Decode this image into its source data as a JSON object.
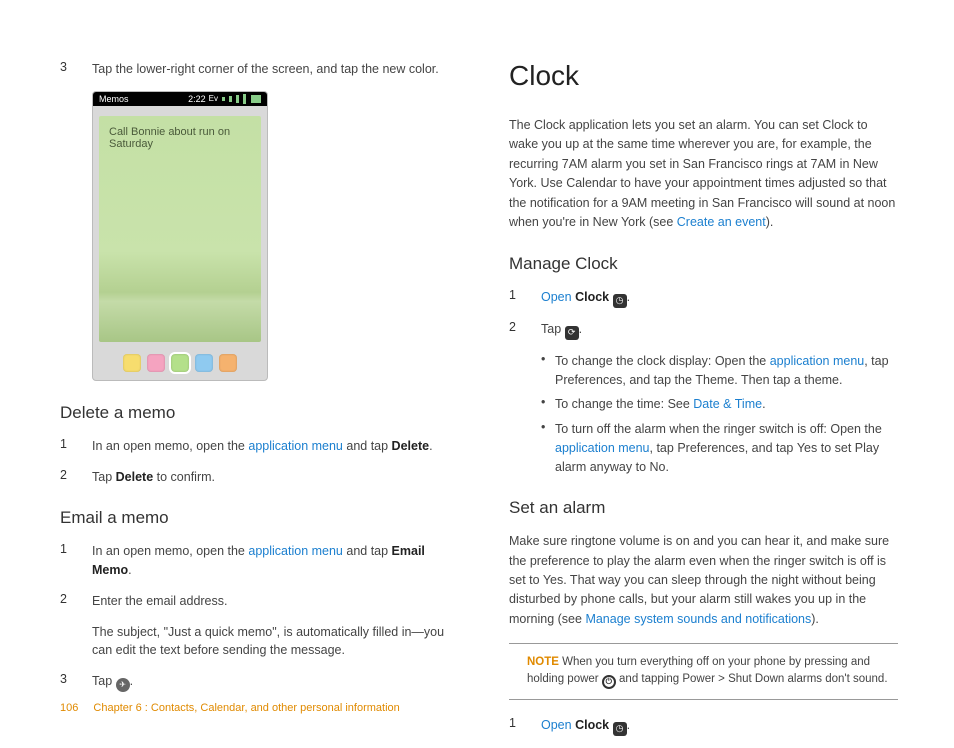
{
  "leftCol": {
    "step3_num": "3",
    "step3_text": "Tap the lower-right corner of the screen, and tap the new color.",
    "phone": {
      "title": "Memos",
      "time": "2:22",
      "memo_text": "Call Bonnie about run on Saturday"
    },
    "h_delete": "Delete a memo",
    "del1_num": "1",
    "del1_a": "In an open memo, open the ",
    "del1_link": "application menu",
    "del1_b": " and tap ",
    "del1_bold": "Delete",
    "del1_c": ".",
    "del2_num": "2",
    "del2_a": "Tap ",
    "del2_bold": "Delete",
    "del2_b": " to confirm.",
    "h_email": "Email a memo",
    "em1_num": "1",
    "em1_a": "In an open memo, open the ",
    "em1_link": "application menu",
    "em1_b": " and tap ",
    "em1_bold": "Email Memo",
    "em1_c": ".",
    "em2_num": "2",
    "em2_text": "Enter the email address.",
    "em2_sub": "The subject, \"Just a quick memo\", is automatically filled in—you can edit the text before sending the message.",
    "em3_num": "3",
    "em3_text": "Tap "
  },
  "rightCol": {
    "h1": "Clock",
    "intro_a": "The Clock application lets you set an alarm. You can set Clock to wake you up at the same time wherever you are, for example, the recurring 7AM alarm you set in San Francisco rings at 7AM in New York. Use Calendar to have your appointment times adjusted so that the notification for a 9AM meeting in San Francisco will sound at noon when you're in New York (see ",
    "intro_link": "Create an event",
    "intro_b": ").",
    "h_manage": "Manage Clock",
    "mc1_num": "1",
    "mc1_link": "Open",
    "mc1_bold": "Clock",
    "mc2_num": "2",
    "mc2_text": "Tap ",
    "b1_a": "To change the clock display: Open the ",
    "b1_link": "application menu",
    "b1_b": ", tap ",
    "b1_bold1": "Preferences",
    "b1_c": ", and tap the ",
    "b1_bold2": "Theme.",
    "b1_d": " Then tap a theme.",
    "b2_a": "To change the time: See ",
    "b2_link": "Date & Time",
    "b2_b": ".",
    "b3_a": "To turn off the alarm when the ringer switch is off: Open the ",
    "b3_link": "application menu",
    "b3_b": ", tap ",
    "b3_bold1": "Preferences",
    "b3_c": ", and tap ",
    "b3_bold2": "Yes",
    "b3_d": " to set ",
    "b3_bold3": "Play alarm anyway",
    "b3_e": " to ",
    "b3_bold4": "No",
    "b3_f": ".",
    "h_set": "Set an alarm",
    "set_para_a": "Make sure ringtone volume is on and you can hear it, and make sure the preference to play the alarm even when the ringer switch is off is set to Yes. That way you can sleep through the night without being disturbed by phone calls, but your alarm still wakes you up in the morning (see ",
    "set_para_link": "Manage system sounds and notifications",
    "set_para_b": ").",
    "note_label": "NOTE",
    "note_a": "  When you turn everything off on your phone by pressing and holding ",
    "note_bold1": "power",
    "note_b": " and tapping ",
    "note_bold2": "Power",
    "note_c": " > ",
    "note_bold3": "Shut Down",
    "note_d": " alarms don't sound.",
    "sa1_num": "1",
    "sa1_link": "Open",
    "sa1_bold": "Clock"
  },
  "footer": {
    "page": "106",
    "chapter": "Chapter 6 : Contacts, Calendar, and other personal information"
  }
}
